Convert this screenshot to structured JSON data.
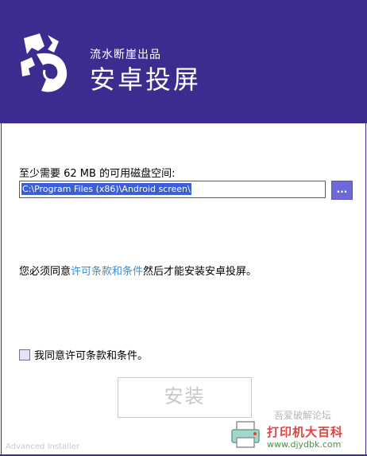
{
  "header": {
    "subtitle": "流水断崖出品",
    "title": "安卓投屏"
  },
  "install_dir": {
    "space_label": "至少需要 62 MB 的可用磁盘空间:",
    "path_value": "C:\\Program Files (x86)\\Android screen\\",
    "browse_label": "..."
  },
  "license": {
    "text_before": "您必须同意",
    "link_text": "许可条款和条件",
    "text_after": "然后才能安装安卓投屏。",
    "checkbox_label": "我同意许可条款和条件。",
    "checkbox_checked": false
  },
  "install_button": {
    "label": "安装",
    "enabled": false
  },
  "footer": {
    "text": "Advanced Installer"
  },
  "watermark": {
    "top_text": "吾爱破解论坛",
    "main_text": "打印机大百科",
    "url": "www.djydbk.com"
  },
  "colors": {
    "header_bg": "#3a2d8f",
    "browse_bg": "#6f68d8",
    "link": "#3b8fd6",
    "disabled": "#c8c8c8"
  }
}
